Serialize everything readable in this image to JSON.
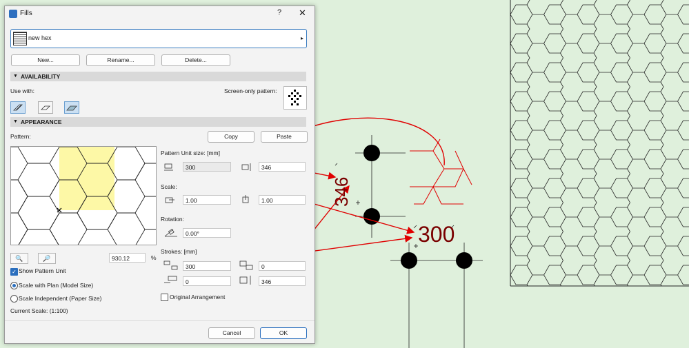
{
  "dialog": {
    "title": "Fills",
    "help_label": "?",
    "close_label": "✕",
    "fill_name": "new hex",
    "buttons": {
      "new": "New...",
      "rename": "Rename...",
      "delete": "Delete..."
    },
    "availability": {
      "header": "AVAILABILITY",
      "use_with_label": "Use with:",
      "screen_only_label": "Screen-only pattern:",
      "use_with_buttons": [
        {
          "name": "drafting-fills-icon",
          "active": true
        },
        {
          "name": "cut-fills-icon",
          "active": false
        },
        {
          "name": "cover-fills-icon",
          "active": true
        }
      ]
    },
    "appearance": {
      "header": "APPEARANCE",
      "pattern_label": "Pattern:",
      "copy_label": "Copy",
      "paste_label": "Paste",
      "unit_size_label": "Pattern Unit size: [mm]",
      "unit_width": "300",
      "unit_height": "346",
      "scale_label": "Scale:",
      "scale_x": "1.00",
      "scale_y": "1.00",
      "rotation_label": "Rotation:",
      "rotation_value": "0.00°",
      "strokes_label": "Strokes: [mm]",
      "stroke_1": "300",
      "stroke_2": "0",
      "stroke_3": "0",
      "stroke_4": "346",
      "original_arrangement_label": "Original Arrangement",
      "zoom_value": "930.12",
      "zoom_unit": "%",
      "show_pattern_unit_label": "Show Pattern Unit",
      "scale_with_plan_label": "Scale with Plan (Model Size)",
      "scale_independent_label": "Scale Independent (Paper Size)",
      "current_scale_label": "Current Scale: (1:100)"
    },
    "cancel_label": "Cancel",
    "ok_label": "OK"
  },
  "canvas": {
    "dim_height": "346",
    "dim_width": "300"
  },
  "colors": {
    "canvas_bg": "#dff0dc",
    "arrow": "#e00000",
    "dimension_text": "#7a0000",
    "pattern_unit_highlight": "#fdf8a6",
    "accent": "#2b6fbe"
  }
}
